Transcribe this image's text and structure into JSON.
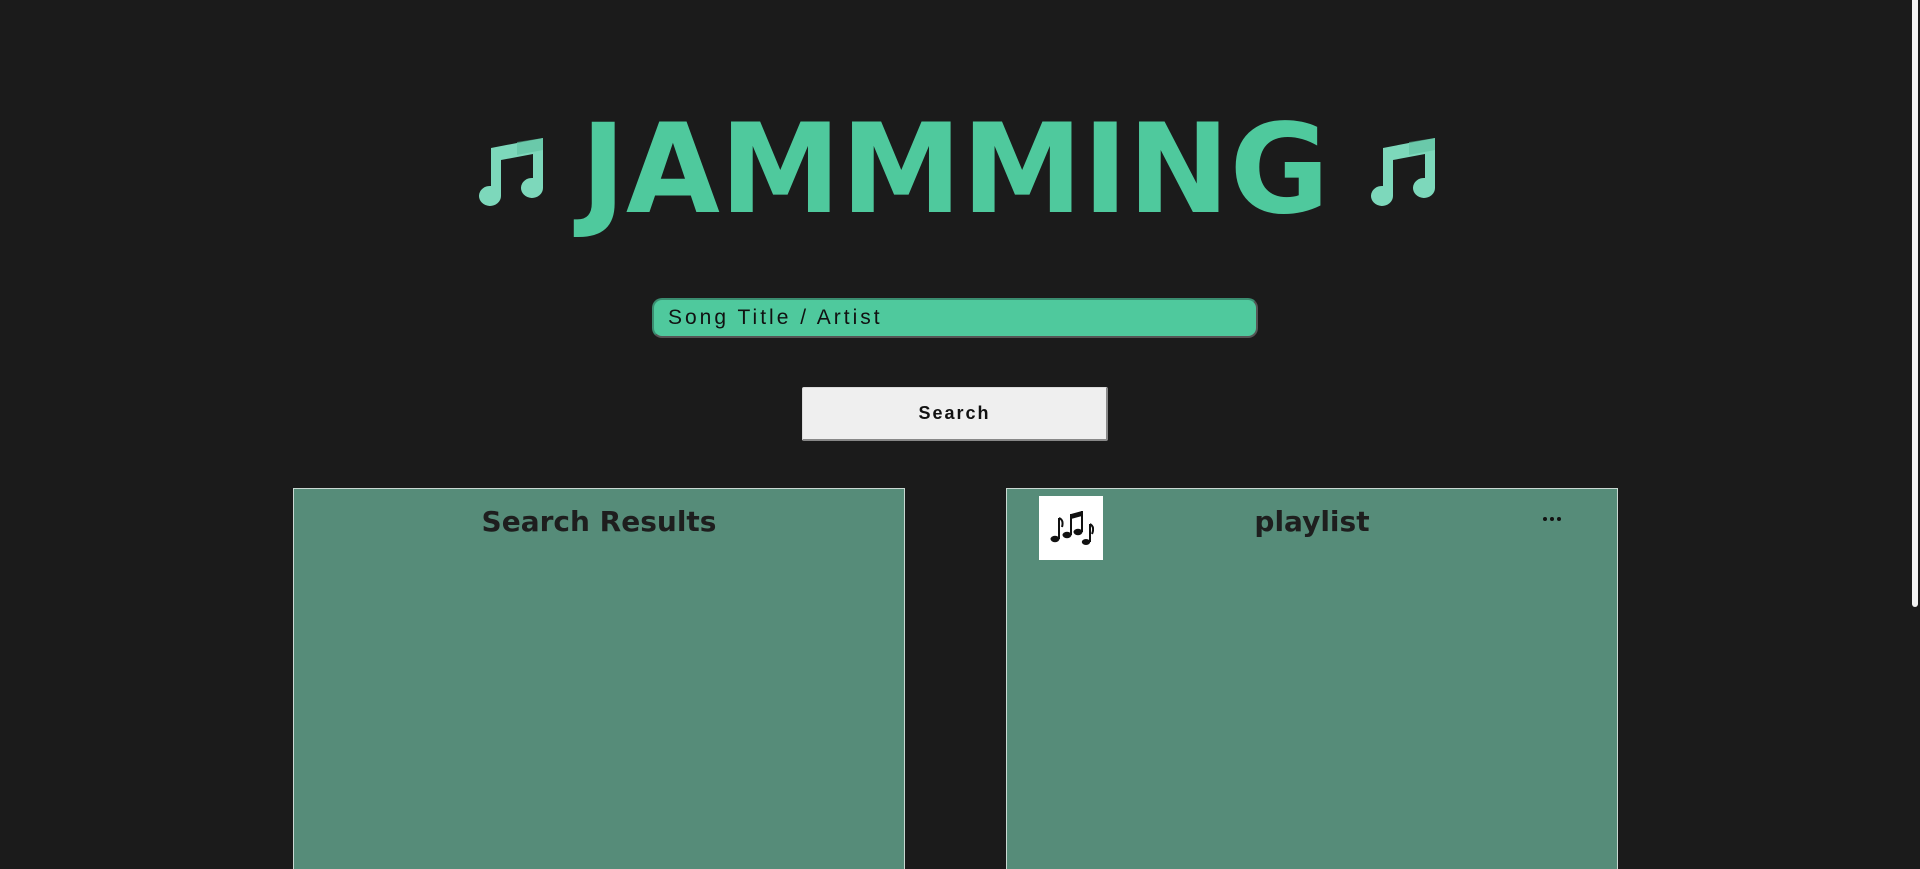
{
  "header": {
    "title": "JAMMMING",
    "accent_color": "#4fc99d",
    "left_icon": "music-note-icon",
    "right_icon": "music-note-icon"
  },
  "search": {
    "placeholder": "Song Title / Artist",
    "value": "",
    "button_label": "Search"
  },
  "results_panel": {
    "title": "Search Results"
  },
  "playlist_panel": {
    "title": "playlist",
    "art_icon": "music-notes-icon",
    "more_icon": "ellipsis-icon"
  },
  "colors": {
    "background": "#1b1b1b",
    "panel": "#568c79",
    "input": "#4fc99d"
  }
}
